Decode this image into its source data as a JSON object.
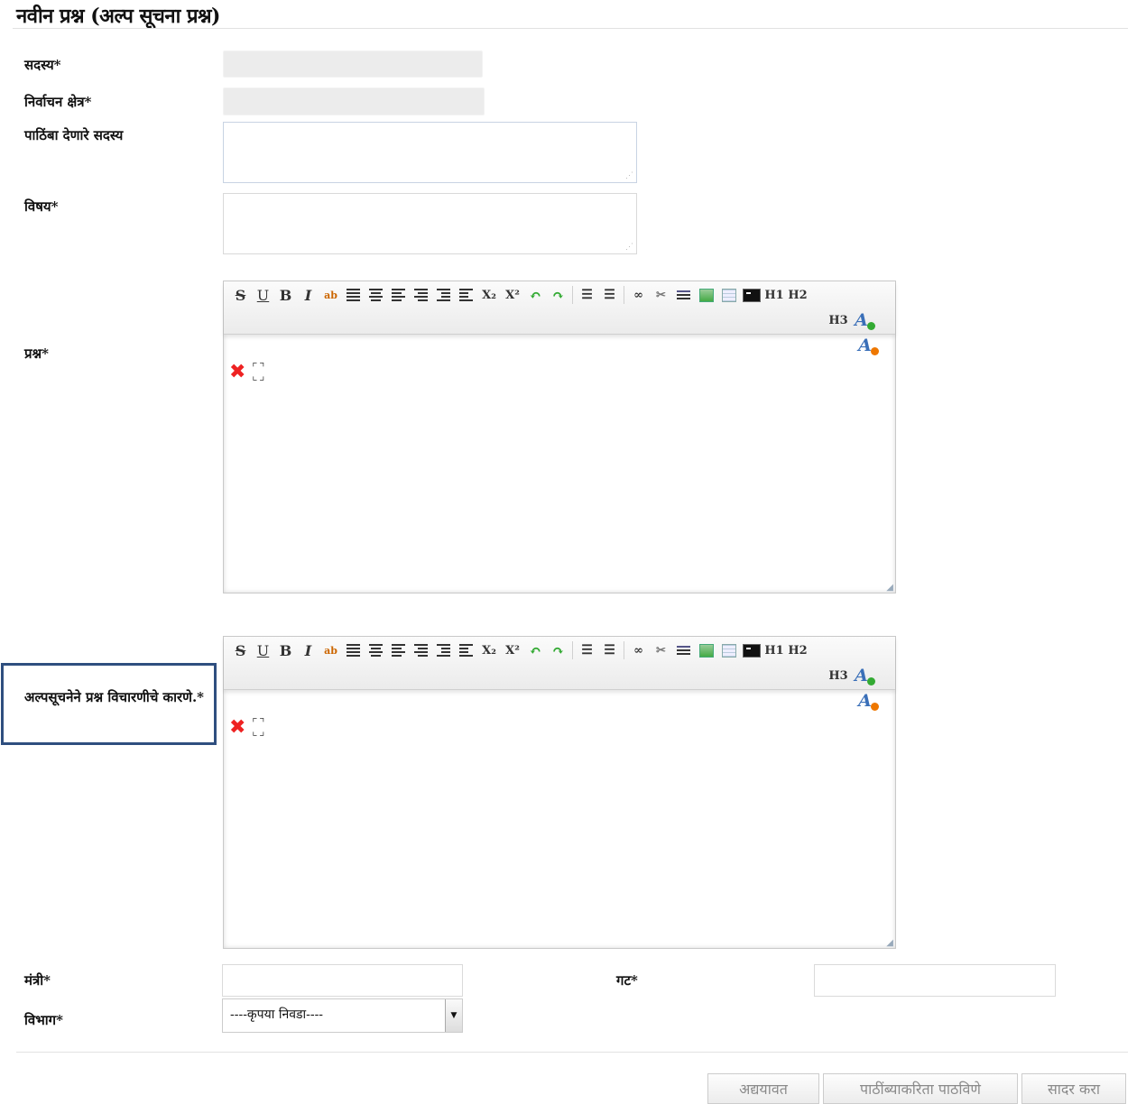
{
  "page": {
    "title": "नवीन प्रश्न (अल्प सूचना प्रश्न)"
  },
  "form": {
    "member_label": "सदस्य*",
    "constituency_label": "निर्वाचन क्षेत्र*",
    "supporting_members_label": "पाठिंबा देणारे सदस्य",
    "subject_label": "विषय*",
    "question_label": "प्रश्न*",
    "reason_label": "अल्पसूचनेने प्रश्न विचारणीचे कारणे.*",
    "minister_label": "मंत्री*",
    "group_label": "गट*",
    "department_label": "विभाग*",
    "department_select": {
      "selected": "----कृपया निवडा----"
    }
  },
  "editor_toolbar": {
    "strike": "S",
    "underline": "U",
    "bold": "B",
    "italic": "I",
    "subscript": "X₂",
    "superscript": "X²",
    "h1": "H1",
    "h2": "H2",
    "h3": "H3"
  },
  "buttons": {
    "update": "अद्ययावत",
    "send_for_support": "पाठींब्याकरिता पाठविणे",
    "submit": "सादर करा"
  },
  "colors": {
    "highlight_border": "#2f4f7f",
    "close_red": "#e22222",
    "font_icon_blue": "#3a6fb8"
  }
}
